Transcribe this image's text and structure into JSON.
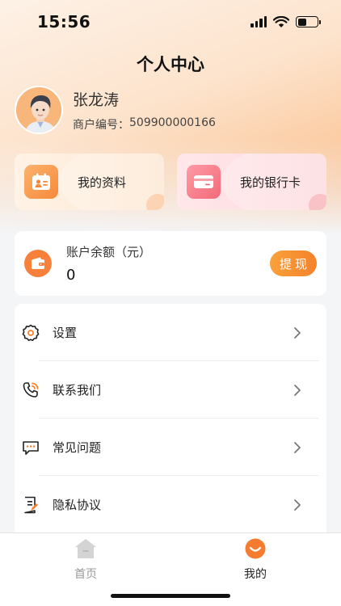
{
  "status_bar": {
    "time": "15:56",
    "battery_level": 0.45
  },
  "header": {
    "title": "个人中心"
  },
  "profile": {
    "name": "张龙涛",
    "merchant_label": "商户编号：",
    "merchant_no": "509900000166"
  },
  "quick_cards": [
    {
      "label": "我的资料",
      "icon": "profile-card-icon"
    },
    {
      "label": "我的银行卡",
      "icon": "bank-card-icon"
    }
  ],
  "balance": {
    "label": "账户余额（元）",
    "value": "0",
    "withdraw_label": "提现"
  },
  "menu": [
    {
      "label": "设置",
      "icon": "gear-icon"
    },
    {
      "label": "联系我们",
      "icon": "phone-icon"
    },
    {
      "label": "常见问题",
      "icon": "chat-icon"
    },
    {
      "label": "隐私协议",
      "icon": "document-icon"
    }
  ],
  "tabbar": [
    {
      "label": "首页",
      "icon": "home-icon",
      "active": false
    },
    {
      "label": "我的",
      "icon": "smile-icon",
      "active": true
    }
  ],
  "colors": {
    "accent": "#f6812c",
    "text": "#222222",
    "muted": "#999999"
  }
}
